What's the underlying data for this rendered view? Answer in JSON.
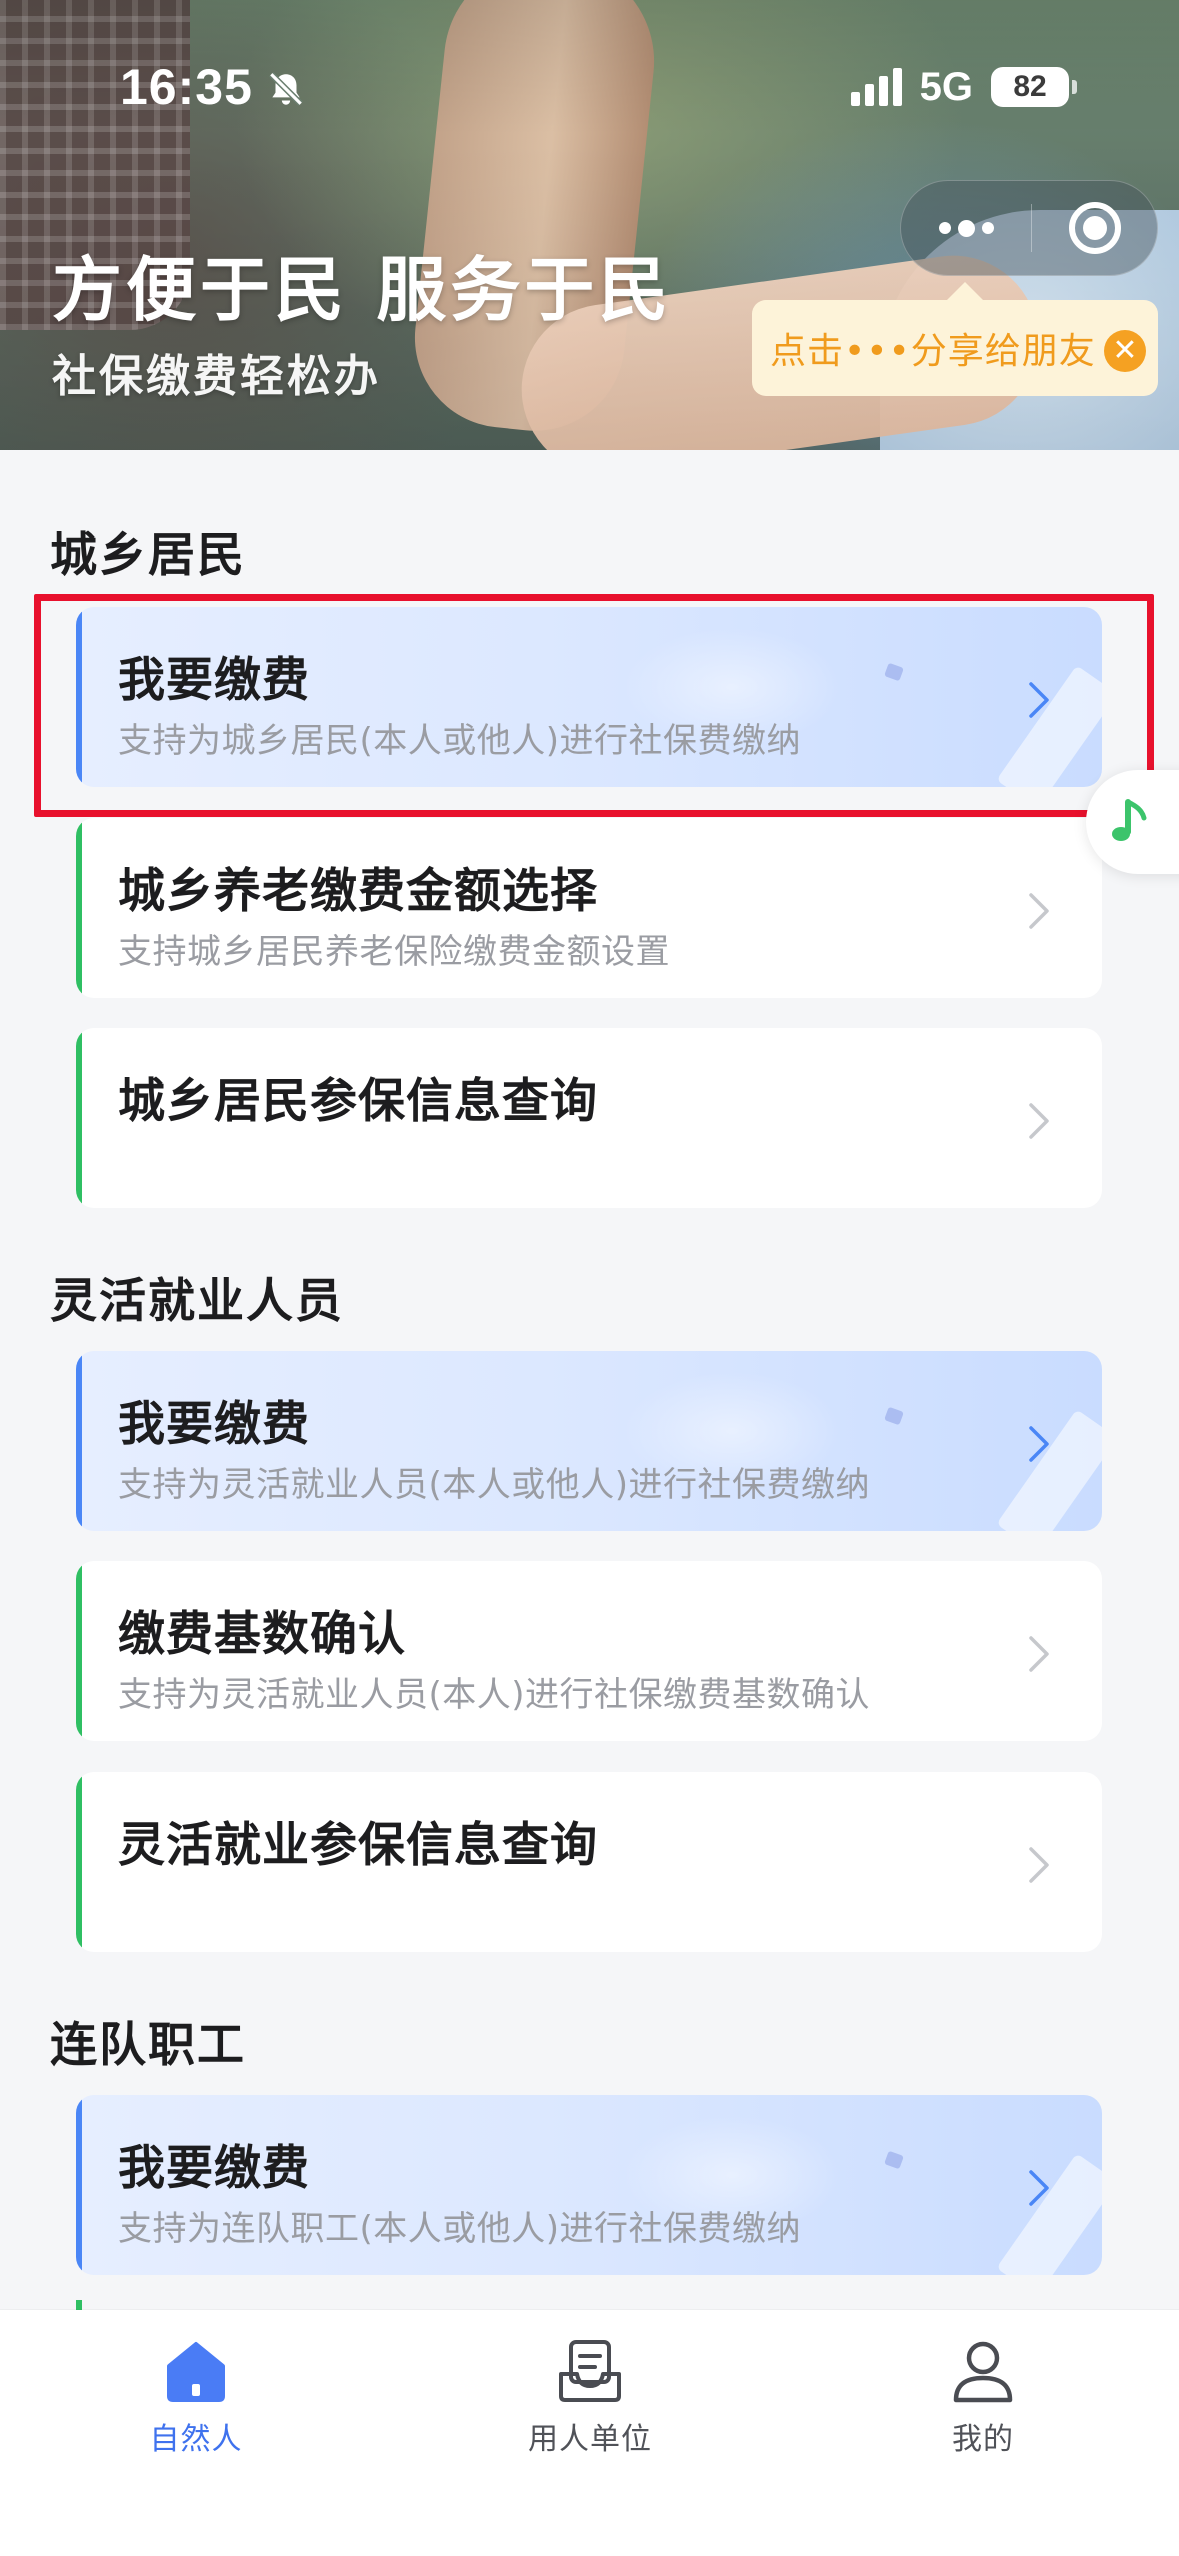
{
  "status_bar": {
    "time": "16:35",
    "network": "5G",
    "battery": "82"
  },
  "header": {
    "slogan": "方便于民 服务于民",
    "sub_slogan": "社保缴费轻松办",
    "share_tip": "点击•••分享给朋友"
  },
  "sections": [
    {
      "title": "城乡居民",
      "cards": [
        {
          "title": "我要缴费",
          "desc": "支持为城乡居民(本人或他人)进行社保费缴纳"
        },
        {
          "title": "城乡养老缴费金额选择",
          "desc": "支持城乡居民养老保险缴费金额设置"
        },
        {
          "title": "城乡居民参保信息查询",
          "desc": ""
        }
      ]
    },
    {
      "title": "灵活就业人员",
      "cards": [
        {
          "title": "我要缴费",
          "desc": "支持为灵活就业人员(本人或他人)进行社保费缴纳"
        },
        {
          "title": "缴费基数确认",
          "desc": "支持为灵活就业人员(本人)进行社保缴费基数确认"
        },
        {
          "title": "灵活就业参保信息查询",
          "desc": ""
        }
      ]
    },
    {
      "title": "连队职工",
      "cards": [
        {
          "title": "我要缴费",
          "desc": "支持为连队职工(本人或他人)进行社保费缴纳"
        }
      ]
    }
  ],
  "tabbar": {
    "items": [
      {
        "label": "自然人",
        "icon": "home-icon",
        "active": true
      },
      {
        "label": "用人单位",
        "icon": "inbox-icon",
        "active": false
      },
      {
        "label": "我的",
        "icon": "user-icon",
        "active": false
      }
    ]
  },
  "colors": {
    "accent_blue": "#4a86f6",
    "accent_green": "#2fbf63",
    "highlight_red": "#e8112d",
    "tip_orange": "#f09b1d",
    "tab_active": "#3f72ee"
  }
}
